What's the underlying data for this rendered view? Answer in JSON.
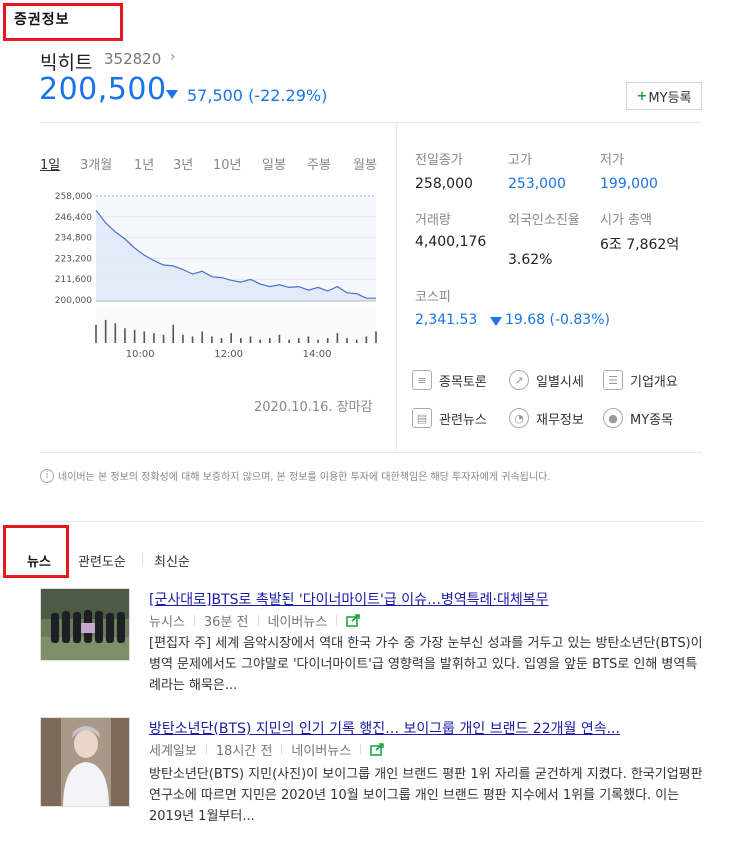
{
  "section": {
    "title": "증권정보"
  },
  "stock": {
    "name": "빅히트",
    "code": "352820",
    "price": "200,500",
    "change": "57,500 (-22.29%)",
    "my_button": "MY등록"
  },
  "periods": [
    "1일",
    "3개월",
    "1년",
    "3년",
    "10년",
    "일봉",
    "주봉",
    "월봉"
  ],
  "chart_data": {
    "type": "line",
    "ylabel": "",
    "yticks": [
      "258,000",
      "246,400",
      "234,800",
      "223,200",
      "211,600",
      "200,000"
    ],
    "ylim": [
      200000,
      258000
    ],
    "xticks": [
      "10:00",
      "12:00",
      "14:00"
    ],
    "x": [
      "09:00",
      "09:05",
      "09:10",
      "09:15",
      "09:20",
      "09:30",
      "09:40",
      "09:50",
      "10:00",
      "10:15",
      "10:30",
      "10:45",
      "11:00",
      "11:15",
      "11:30",
      "11:45",
      "12:00",
      "12:15",
      "12:30",
      "12:45",
      "13:00",
      "13:15",
      "13:30",
      "13:45",
      "14:00",
      "14:15",
      "14:30",
      "14:45",
      "15:00",
      "15:20"
    ],
    "values": [
      250000,
      243000,
      238000,
      234000,
      229000,
      225000,
      222000,
      219500,
      219000,
      217000,
      214500,
      216000,
      213000,
      212500,
      211000,
      210000,
      211500,
      209000,
      207500,
      208500,
      207000,
      207500,
      205500,
      207000,
      205000,
      207500,
      204000,
      203500,
      201000,
      201000
    ],
    "volume": [
      0.55,
      0.7,
      0.6,
      0.45,
      0.4,
      0.35,
      0.3,
      0.25,
      0.55,
      0.25,
      0.2,
      0.35,
      0.2,
      0.15,
      0.3,
      0.15,
      0.2,
      0.1,
      0.15,
      0.25,
      0.1,
      0.15,
      0.2,
      0.1,
      0.15,
      0.3,
      0.15,
      0.1,
      0.2,
      0.35
    ],
    "grid": true,
    "colors": {
      "line": "#4a6fd6",
      "fill": "#dfe7f7",
      "volume": "#555555"
    }
  },
  "chart_date": "2020.10.16. 장마감",
  "info": {
    "prev_close_label": "전일종가",
    "prev_close": "258,000",
    "high_label": "고가",
    "high": "253,000",
    "low_label": "저가",
    "low": "199,000",
    "volume_label": "거래량",
    "volume": "4,400,176",
    "foreign_label": "외국인소진율",
    "foreign": "3.62%",
    "marketcap_label": "시가 총액",
    "marketcap": "6조 7,862억",
    "kospi_label": "코스피",
    "kospi": "2,341.53",
    "kospi_change": "19.68 (-0.83%)"
  },
  "links": [
    {
      "label": "종목토론",
      "icon": "chat-icon"
    },
    {
      "label": "일별시세",
      "icon": "trend-icon"
    },
    {
      "label": "기업개요",
      "icon": "company-icon"
    },
    {
      "label": "관련뉴스",
      "icon": "news-icon"
    },
    {
      "label": "재무정보",
      "icon": "piechart-icon"
    },
    {
      "label": "MY종목",
      "icon": "user-icon"
    }
  ],
  "notice": "네이버는 본 정보의 정확성에 대해 보증하지 않으며, 본 정보를 이용한 투자에 대한책임은 해당 투자자에게 귀속됩니다.",
  "news_tabs": [
    "뉴스",
    "관련도순",
    "최신순"
  ],
  "news": [
    {
      "title": "[군사대로]BTS로 촉발된 '다이너마이트'급 이슈…병역특례·대체복무",
      "source": "뉴시스",
      "time": "36분 전",
      "portal": "네이버뉴스",
      "body": "[편집자 주] 세계 음악시장에서 역대 한국 가수 중 가장 눈부신 성과를 거두고 있는 방탄소년단(BTS)이 병역 문제에서도 그야말로 '다이너마이트'급 영향력을 발휘하고 있다. 입영을 앞둔 BTS로 인해 병역특례라는 해묵은..."
    },
    {
      "title": "방탄소년단(BTS) 지민의 인기 기록 행진… 보이그룹 개인 브랜드 22개월 연속...",
      "source": "세계일보",
      "time": "18시간 전",
      "portal": "네이버뉴스",
      "body": "방탄소년단(BTS) 지민(사진)이 보이그룹 개인 브랜드 평판 1위 자리를 굳건하게 지켰다. 한국기업평판연구소에 따르면 지민은 2020년 10월 보이그룹 개인 브랜드 평판 지수에서 1위를 기록했다. 이는 2019년 1월부터..."
    }
  ]
}
